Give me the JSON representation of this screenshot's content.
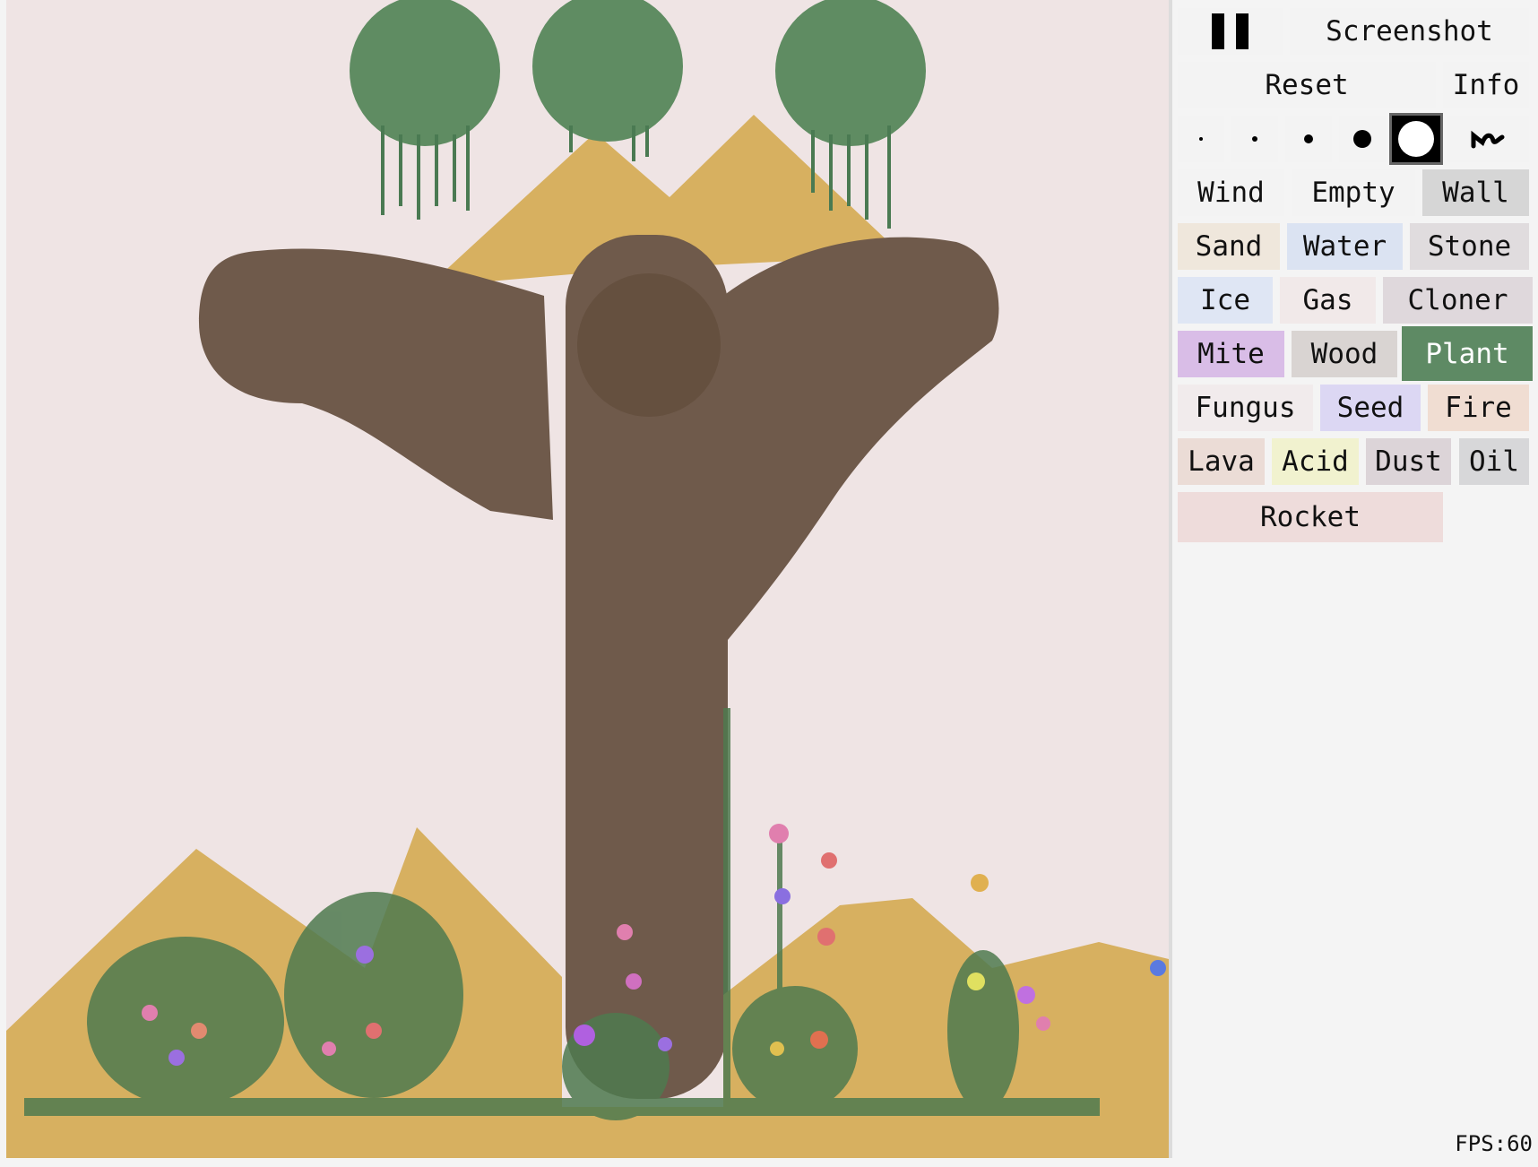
{
  "controls": {
    "pause_icon": "pause-icon",
    "screenshot": "Screenshot",
    "reset": "Reset",
    "info": "Info",
    "brush_sizes": [
      "1",
      "2",
      "3",
      "4",
      "5"
    ],
    "selected_brush": 5,
    "replace_mode_icon": "squiggle-icon"
  },
  "elements": [
    {
      "label": "Wind",
      "color": "#f3f3f3"
    },
    {
      "label": "Empty",
      "color": "#f3f3f3"
    },
    {
      "label": "Wall",
      "color": "#d6d6d6"
    },
    {
      "label": "Sand",
      "color": "#efe7dc"
    },
    {
      "label": "Water",
      "color": "#dbe3f2"
    },
    {
      "label": "Stone",
      "color": "#e0dcde"
    },
    {
      "label": "Ice",
      "color": "#dfe6f4"
    },
    {
      "label": "Gas",
      "color": "#f1e9e9"
    },
    {
      "label": "Cloner",
      "color": "#dfd8dc"
    },
    {
      "label": "Mite",
      "color": "#d9bde7"
    },
    {
      "label": "Wood",
      "color": "#d9d4d2"
    },
    {
      "label": "Plant",
      "color": "#5e8a64"
    },
    {
      "label": "Fungus",
      "color": "#f1ebec"
    },
    {
      "label": "Seed",
      "color": "#dcd7f3"
    },
    {
      "label": "Fire",
      "color": "#f0ddd2"
    },
    {
      "label": "Lava",
      "color": "#ebdcd6"
    },
    {
      "label": "Acid",
      "color": "#f1f2cf"
    },
    {
      "label": "Dust",
      "color": "#dcd4d8"
    },
    {
      "label": "Oil",
      "color": "#d7d7d9"
    },
    {
      "label": "Rocket",
      "color": "#eedcdb"
    }
  ],
  "selected_element": "Plant",
  "fps": "FPS:60",
  "colors": {
    "sand": "#d7b060",
    "wood": "#6f5a4b",
    "plant": "#5f8c62",
    "background": "#efe4e4"
  }
}
